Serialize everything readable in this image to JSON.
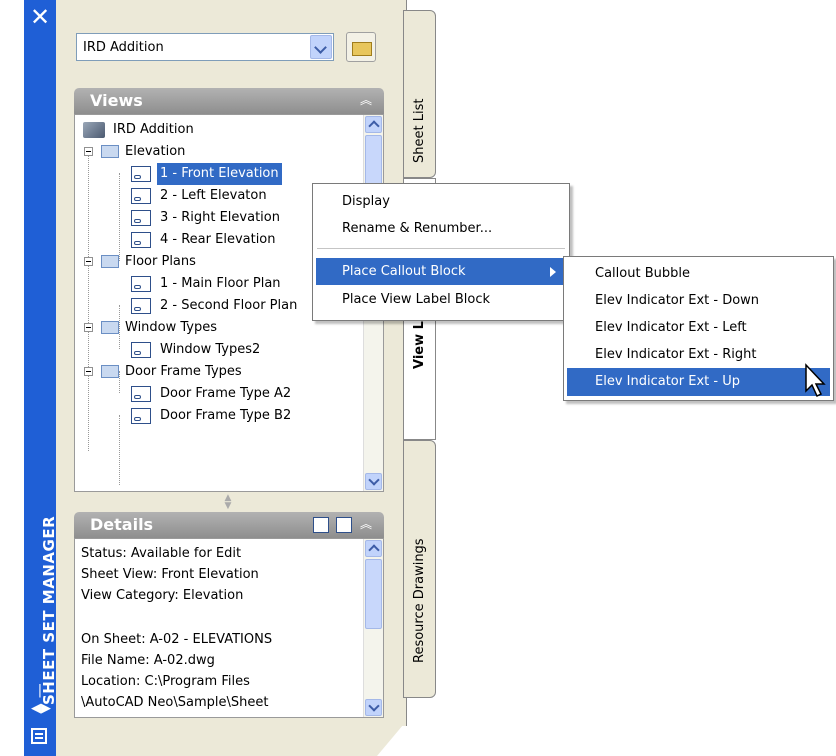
{
  "palette": {
    "title": "SHEET SET MANAGER",
    "close_glyph": "✕",
    "autohide_glyph": "|◀▶"
  },
  "sheetset_combo": {
    "value": "IRD Addition"
  },
  "views_section": {
    "title": "Views",
    "tree": {
      "root": "IRD Addition",
      "categories": [
        {
          "name": "Elevation",
          "views": [
            "1 - Front Elevation",
            "2 - Left Elevaton",
            "3 - Right Elevation",
            "4 - Rear Elevation"
          ]
        },
        {
          "name": "Floor Plans",
          "views": [
            "1 - Main Floor Plan",
            "2 - Second Floor Plan"
          ]
        },
        {
          "name": "Window Types",
          "views": [
            "Window Types2"
          ]
        },
        {
          "name": "Door Frame Types",
          "views": [
            "Door Frame Type A2",
            "Door Frame Type B2"
          ]
        }
      ]
    },
    "selected_view": "1 - Front Elevation"
  },
  "details_section": {
    "title": "Details",
    "lines": [
      "Status: Available for Edit",
      "Sheet View: Front Elevation",
      "View Category: Elevation",
      "",
      "On Sheet: A-02 - ELEVATIONS",
      "File Name: A-02.dwg",
      "Location: C:\\Program Files",
      "\\AutoCAD Neo\\Sample\\Sheet"
    ]
  },
  "tabs": {
    "sheet_list": "Sheet List",
    "view_list": "View List",
    "resource_drawings": "Resource Drawings"
  },
  "context_menu": {
    "items": [
      "Display",
      "Rename & Renumber...",
      "Place Callout Block",
      "Place View Label Block"
    ],
    "highlighted": "Place Callout Block"
  },
  "submenu": {
    "items": [
      "Callout Bubble",
      "Elev Indicator Ext - Down",
      "Elev Indicator Ext - Left",
      "Elev Indicator Ext - Right",
      "Elev Indicator Ext - Up"
    ],
    "highlighted": "Elev Indicator Ext - Up"
  },
  "colors": {
    "title_strip": "#1f5fd6",
    "selection": "#316ac5",
    "panel": "#ece9d8"
  }
}
